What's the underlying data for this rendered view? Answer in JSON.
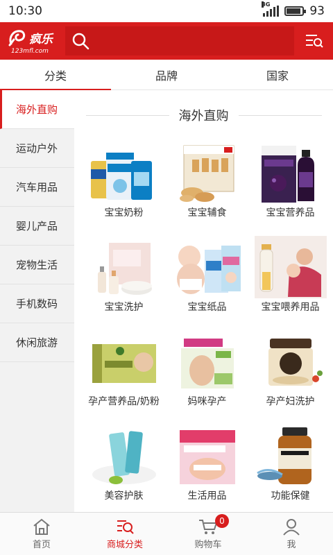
{
  "status_bar": {
    "time": "10:30",
    "network": "3G",
    "battery": "93"
  },
  "header": {
    "logo_text": "疯乐",
    "logo_sub": "123mfl.com",
    "search_placeholder": ""
  },
  "tabs": [
    {
      "label": "分类"
    },
    {
      "label": "品牌"
    },
    {
      "label": "国家"
    }
  ],
  "sidebar": {
    "items": [
      {
        "label": "海外直购"
      },
      {
        "label": "运动户外"
      },
      {
        "label": "汽车用品"
      },
      {
        "label": "婴儿产品"
      },
      {
        "label": "宠物生活"
      },
      {
        "label": "手机数码"
      },
      {
        "label": "休闲旅游"
      }
    ]
  },
  "section": {
    "title": "海外直购"
  },
  "products": [
    {
      "label": "宝宝奶粉"
    },
    {
      "label": "宝宝辅食"
    },
    {
      "label": "宝宝营养品"
    },
    {
      "label": "宝宝洗护"
    },
    {
      "label": "宝宝纸品"
    },
    {
      "label": "宝宝喂养用品"
    },
    {
      "label": "孕产营养品/奶粉"
    },
    {
      "label": "妈咪孕产"
    },
    {
      "label": "孕产妇洗护"
    },
    {
      "label": "美容护肤"
    },
    {
      "label": "生活用品"
    },
    {
      "label": "功能保健"
    }
  ],
  "bottom_nav": [
    {
      "label": "首页",
      "icon": "home-icon"
    },
    {
      "label": "商城分类",
      "icon": "category-search-icon"
    },
    {
      "label": "购物车",
      "icon": "cart-icon",
      "badge": "0"
    },
    {
      "label": "我",
      "icon": "user-icon"
    }
  ],
  "colors": {
    "accent": "#d81e1e",
    "sidebar_bg": "#f2f2f2"
  }
}
